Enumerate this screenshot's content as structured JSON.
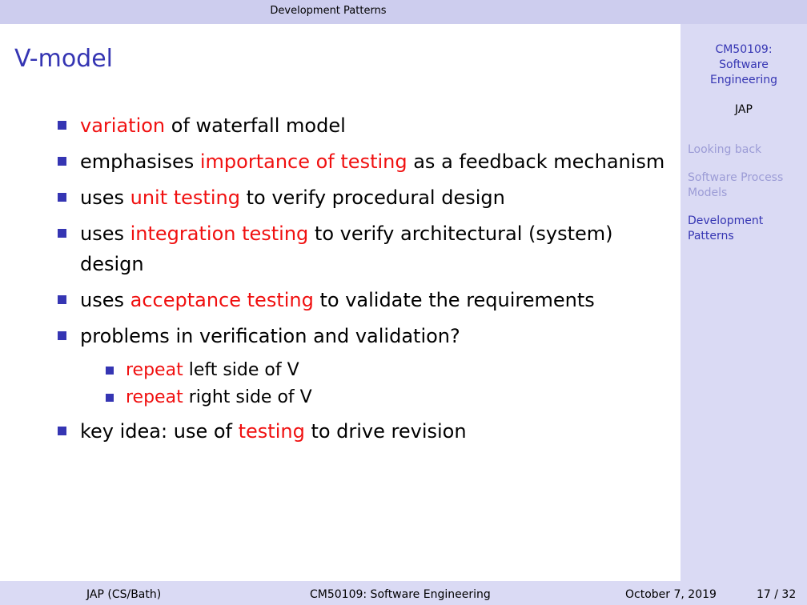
{
  "header": {
    "section": "Development Patterns"
  },
  "slide": {
    "title": "V-model",
    "items": [
      {
        "hl": "variation",
        "after": " of waterfall model"
      },
      {
        "before": "emphasises ",
        "hl": "importance of testing",
        "after": " as a feedback mechanism"
      },
      {
        "before": "uses ",
        "hl": "unit testing",
        "after": " to verify procedural design"
      },
      {
        "before": "uses ",
        "hl": "integration testing",
        "after": " to verify architectural (system) design"
      },
      {
        "before": "uses ",
        "hl": "acceptance testing",
        "after": " to validate the requirements"
      },
      {
        "before": "problems in verification and validation?"
      },
      {
        "before": "key idea:  use of ",
        "hl": "testing",
        "after": " to drive revision"
      }
    ],
    "subitems": [
      {
        "hl": "repeat",
        "after": " left side of V"
      },
      {
        "hl": "repeat",
        "after": " right side of V"
      }
    ]
  },
  "sidebar": {
    "course_line1": "CM50109:",
    "course_line2": "Software",
    "course_line3": "Engineering",
    "author": "JAP",
    "nav": [
      {
        "label": "Looking back"
      },
      {
        "label": "Software Process Models"
      },
      {
        "label": "Development Patterns"
      }
    ]
  },
  "footer": {
    "author": "JAP  (CS/Bath)",
    "course": "CM50109: Software Engineering",
    "date": "October 7, 2019",
    "page": "17 / 32"
  },
  "colors": {
    "accent": "#3535b3",
    "highlight": "#f01010",
    "nav_inactive": "#9c9cd6",
    "headline_bg": "#cdcdee",
    "sidebar_bg": "#dadaf4"
  }
}
